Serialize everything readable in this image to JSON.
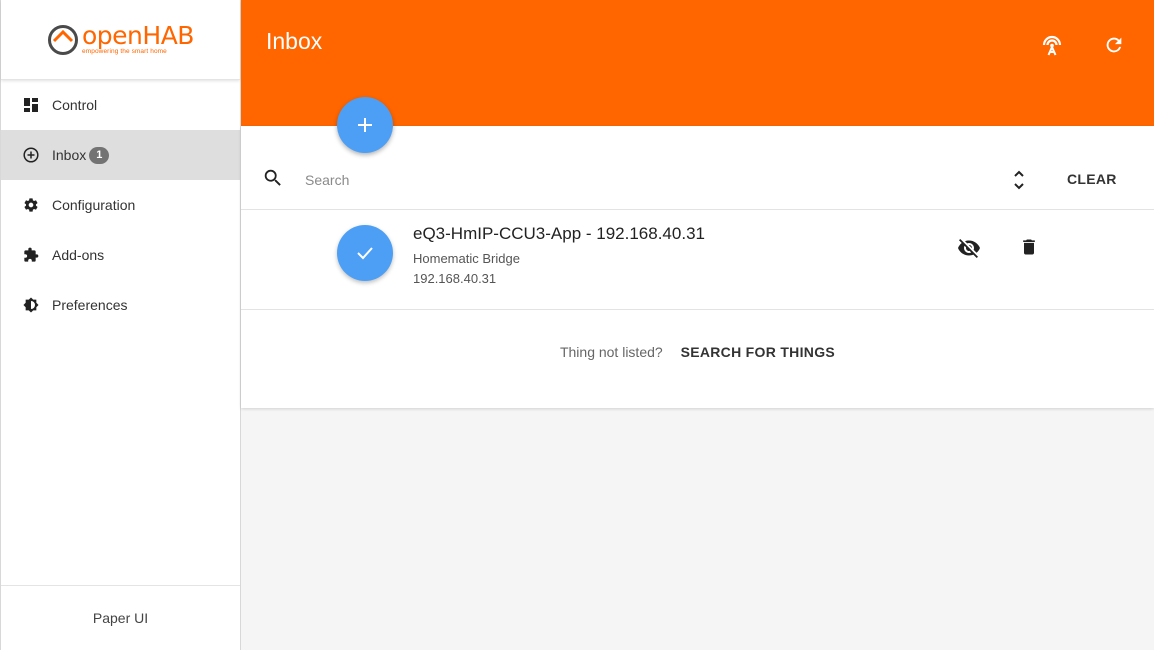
{
  "app": {
    "logo_text_open": "open",
    "logo_text_hab": "HAB",
    "logo_tagline": "empowering the smart home",
    "accent_color": "#ff6600",
    "fab_color": "#4d9ff5"
  },
  "sidebar": {
    "items": [
      {
        "label": "Control",
        "icon": "dashboard-icon"
      },
      {
        "label": "Inbox",
        "icon": "add-circle-icon",
        "badge": "1",
        "active": true
      },
      {
        "label": "Configuration",
        "icon": "gear-icon"
      },
      {
        "label": "Add-ons",
        "icon": "puzzle-icon"
      },
      {
        "label": "Preferences",
        "icon": "brightness-icon"
      }
    ],
    "footer": "Paper UI"
  },
  "header": {
    "title": "Inbox",
    "actions": [
      "discovery-icon",
      "refresh-icon"
    ]
  },
  "search": {
    "placeholder": "Search",
    "clear_label": "CLEAR"
  },
  "inbox": {
    "items": [
      {
        "title": "eQ3-HmIP-CCU3-App - 192.168.40.31",
        "type": "Homematic Bridge",
        "address": "192.168.40.31"
      }
    ]
  },
  "footer": {
    "not_listed": "Thing not listed?",
    "search_things": "SEARCH FOR THINGS"
  }
}
